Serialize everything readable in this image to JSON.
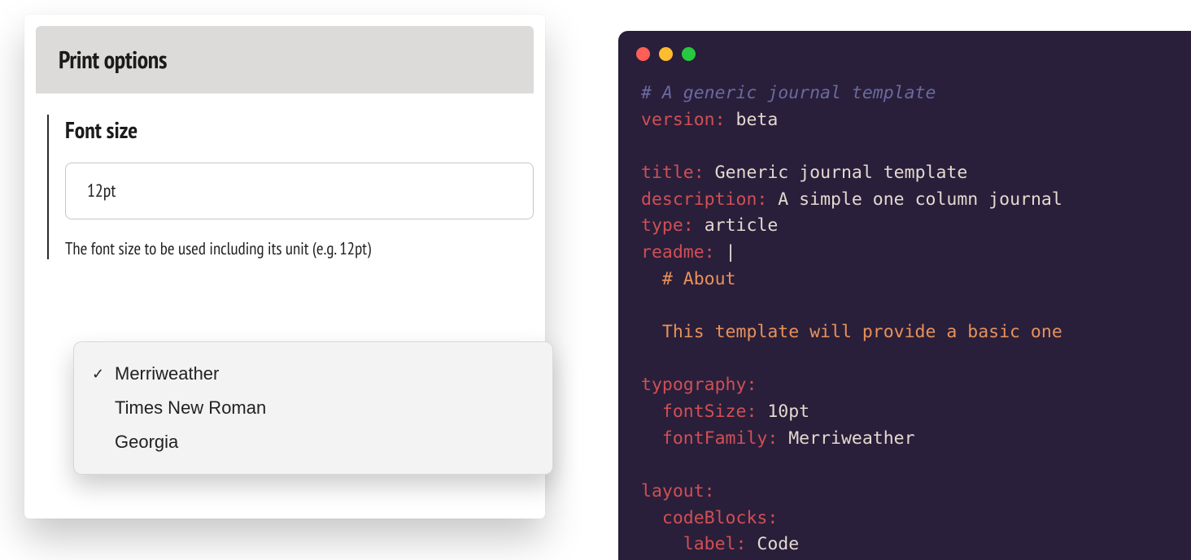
{
  "left": {
    "header_title": "Print options",
    "font_section": {
      "title": "Font size",
      "value": "12pt",
      "help": "The font size to be used including its unit (e.g. 12pt)"
    },
    "dropdown": {
      "items": [
        {
          "label": "Merriweather",
          "selected": true
        },
        {
          "label": "Times New Roman",
          "selected": false
        },
        {
          "label": "Georgia",
          "selected": false
        }
      ]
    }
  },
  "code": {
    "comment": "# A generic journal template",
    "version_key": "version:",
    "version_val": "beta",
    "title_key": "title:",
    "title_val": "Generic journal template",
    "description_key": "description:",
    "description_val": "A simple one column journal",
    "type_key": "type:",
    "type_val": "article",
    "readme_key": "readme:",
    "readme_pipe": "|",
    "readme_l1": "# About",
    "readme_l2": "This template will provide a basic one",
    "typography_key": "typography:",
    "fontSize_key": "fontSize:",
    "fontSize_val": "10pt",
    "fontFamily_key": "fontFamily:",
    "fontFamily_val": "Merriweather",
    "layout_key": "layout:",
    "codeBlocks_key": "codeBlocks:",
    "label_key": "label:",
    "label_val": "Code"
  }
}
